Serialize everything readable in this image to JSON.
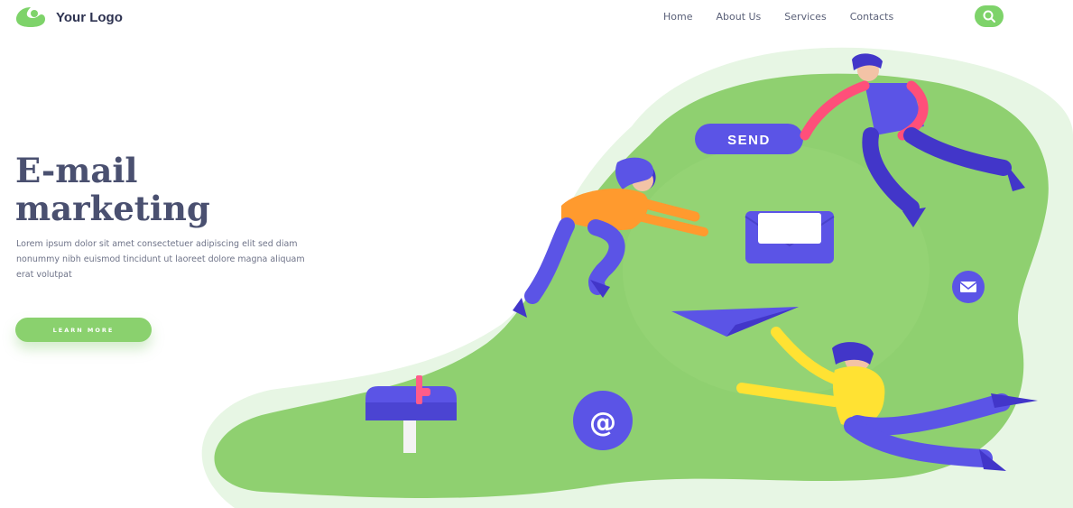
{
  "brand": {
    "logo_text": "Your Logo"
  },
  "nav": {
    "items": [
      "Home",
      "About Us",
      "Services",
      "Contacts"
    ]
  },
  "hero": {
    "title_line1": "E-mail",
    "title_line2": "marketing",
    "body": "Lorem ipsum dolor sit amet consectetuer adipiscing elit sed diam nonummy nibh euismod tincidunt ut laoreet dolore magna aliquam erat volutpat",
    "cta_label": "LEARN MORE"
  },
  "illustration": {
    "send_label": "SEND",
    "at_symbol": "@"
  },
  "colors": {
    "accent_green": "#7ed36a",
    "blob_green": "#8fd070",
    "purple": "#5b54e6",
    "title_text": "#4a5070"
  }
}
